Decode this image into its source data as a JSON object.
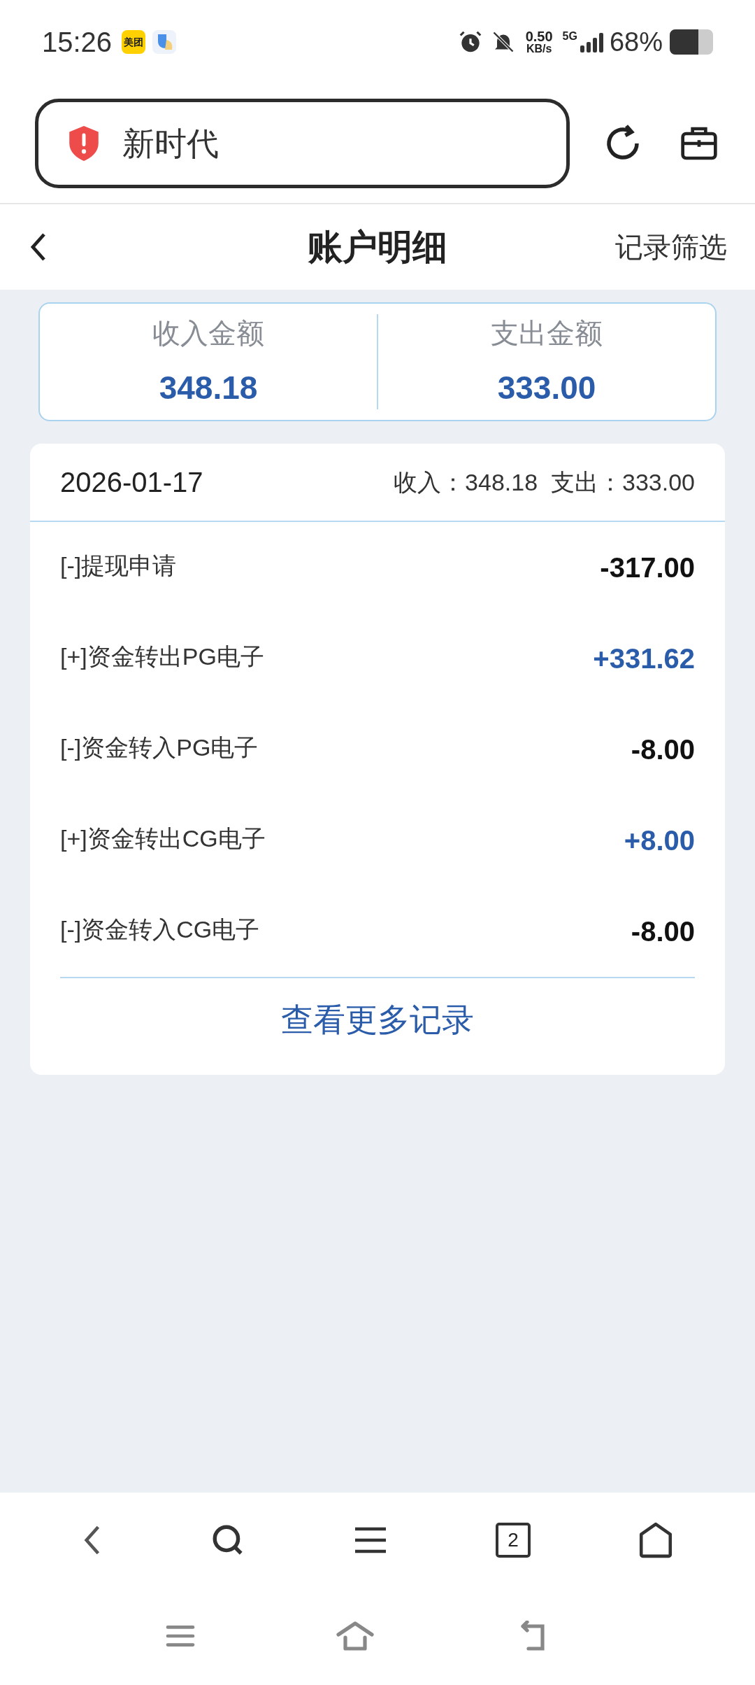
{
  "status_bar": {
    "time": "15:26",
    "app_badge": "美团",
    "speed_value": "0.50",
    "speed_unit": "KB/s",
    "network": "5G",
    "battery": "68%"
  },
  "address_bar": {
    "title": "新时代"
  },
  "header": {
    "title": "账户明细",
    "action": "记录筛选"
  },
  "summary": [
    {
      "label": "收入金额",
      "value": "348.18"
    },
    {
      "label": "支出金额",
      "value": "333.00"
    }
  ],
  "day": {
    "date": "2026-01-17",
    "income_label": "收入：",
    "income": "348.18",
    "expense_label": "支出：",
    "expense": "333.00"
  },
  "records": [
    {
      "name": "[-]提现申请",
      "amount": "-317.00",
      "kind": "expense"
    },
    {
      "name": "[+]资金转出PG电子",
      "amount": "+331.62",
      "kind": "income"
    },
    {
      "name": "[-]资金转入PG电子",
      "amount": "-8.00",
      "kind": "expense"
    },
    {
      "name": "[+]资金转出CG电子",
      "amount": "+8.00",
      "kind": "income"
    },
    {
      "name": "[-]资金转入CG电子",
      "amount": "-8.00",
      "kind": "expense"
    }
  ],
  "more_link": "查看更多记录",
  "browser_toolbar": {
    "tab_count": "2"
  }
}
